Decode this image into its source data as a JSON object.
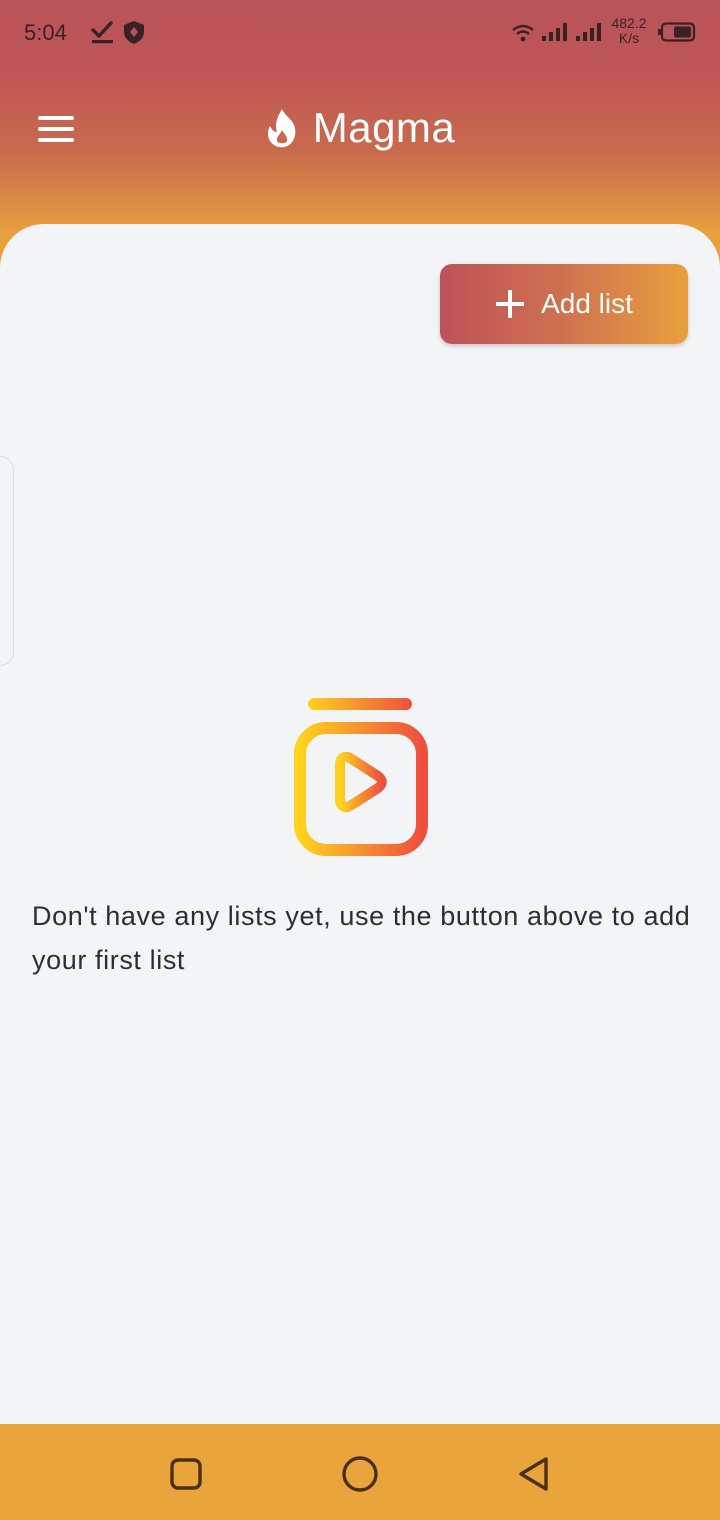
{
  "status_bar": {
    "time": "5:04",
    "network_speed_value": "482.2",
    "network_speed_unit": "K/s"
  },
  "app_bar": {
    "title": "Magma"
  },
  "main": {
    "add_button_label": "Add list",
    "empty_message": "Don't have any lists yet, use the button above to add your first list"
  },
  "colors": {
    "header_top": "#b8535a",
    "header_bottom": "#e9a13e",
    "background": "#f3f4f6",
    "nav_bar": "#e9a43c",
    "empty_icon_start": "#ffd21f",
    "empty_icon_end": "#ee4f3f"
  },
  "icons": {
    "menu": "hamburger-menu-icon",
    "logo": "flame-icon",
    "add": "plus-icon",
    "empty_state": "video-playlist-icon",
    "nav": [
      "square-icon",
      "circle-icon",
      "triangle-back-icon"
    ]
  }
}
